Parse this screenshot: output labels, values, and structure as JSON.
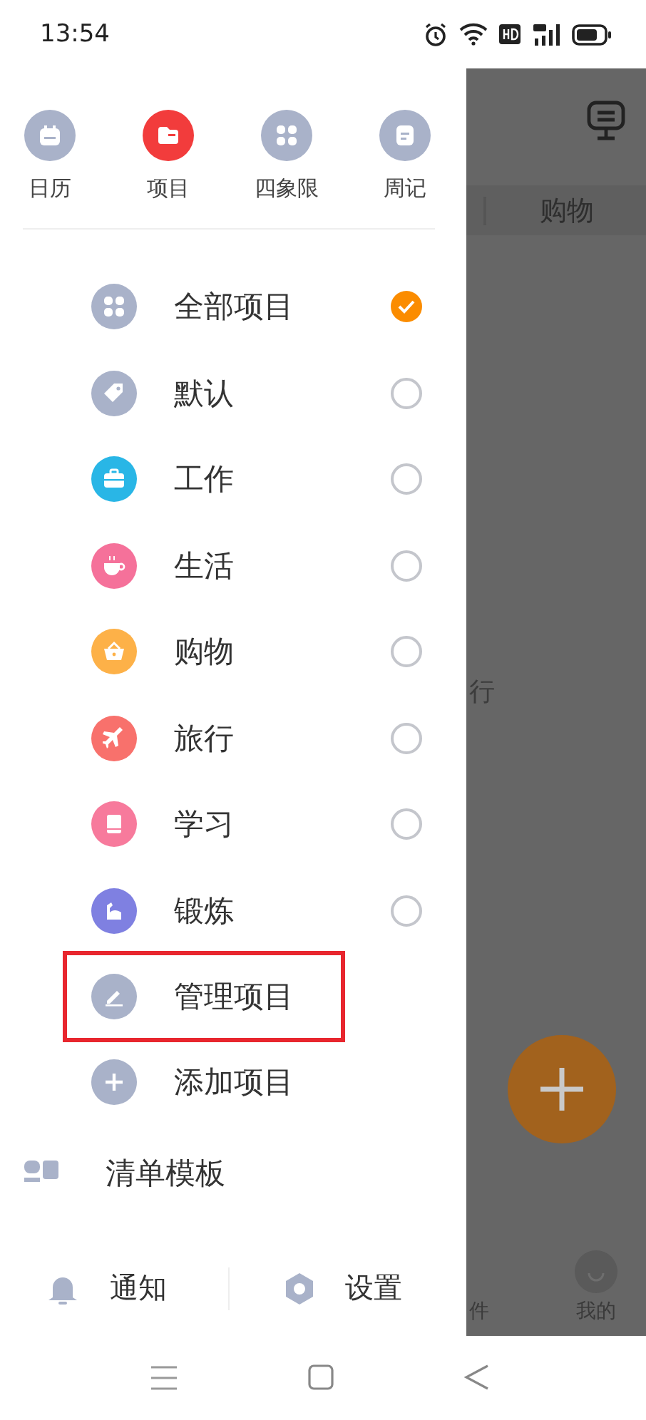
{
  "status_bar": {
    "time": "13:54"
  },
  "shortcuts": [
    {
      "label": "日历",
      "kind": "calendar",
      "selected": false
    },
    {
      "label": "项目",
      "kind": "folder",
      "selected": true
    },
    {
      "label": "四象限",
      "kind": "grid",
      "selected": false
    },
    {
      "label": "周记",
      "kind": "note",
      "selected": false
    }
  ],
  "projects": [
    {
      "label": "全部项目",
      "kind": "grid",
      "color": "#a9b2c9",
      "selected": true
    },
    {
      "label": "默认",
      "kind": "tag",
      "color": "#a9b2c9",
      "selected": false
    },
    {
      "label": "工作",
      "kind": "briefcase",
      "color": "#29b6e6",
      "selected": false
    },
    {
      "label": "生活",
      "kind": "cup",
      "color": "#f5719a",
      "selected": false
    },
    {
      "label": "购物",
      "kind": "basket",
      "color": "#fdb148",
      "selected": false
    },
    {
      "label": "旅行",
      "kind": "plane",
      "color": "#f8716c",
      "selected": false
    },
    {
      "label": "学习",
      "kind": "book",
      "color": "#f77a9c",
      "selected": false
    },
    {
      "label": "锻炼",
      "kind": "arm",
      "color": "#7f80e1",
      "selected": false
    }
  ],
  "actions": [
    {
      "label": "管理项目",
      "kind": "edit",
      "highlighted": true
    },
    {
      "label": "添加项目",
      "kind": "add",
      "highlighted": false
    }
  ],
  "templates": {
    "label": "清单模板"
  },
  "footer": [
    {
      "label": "通知",
      "kind": "bell"
    },
    {
      "label": "设置",
      "kind": "settings"
    }
  ],
  "background": {
    "tab": "购物",
    "fragment": "行",
    "nav": [
      {
        "label": "件",
        "kind": "partial"
      },
      {
        "label": "我的",
        "kind": "avatar"
      }
    ]
  }
}
